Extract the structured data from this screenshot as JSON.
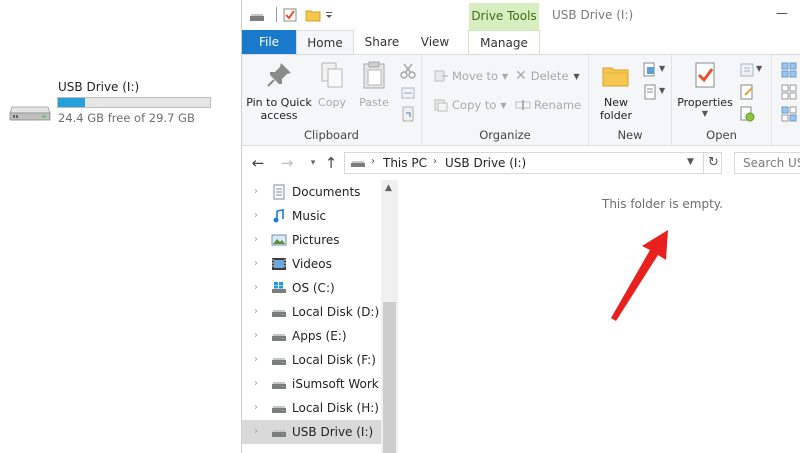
{
  "drive_tile": {
    "name": "USB Drive (I:)",
    "free_text": "24.4 GB free of 29.7 GB",
    "used_fraction": 0.18,
    "bar_color": "#26a0da"
  },
  "titlebar": {
    "contextual_tab": "Drive Tools",
    "window_title": "USB Drive (I:)",
    "minimize_glyph": "—"
  },
  "tabs": {
    "file": "File",
    "home": "Home",
    "share": "Share",
    "view": "View",
    "manage": "Manage"
  },
  "ribbon": {
    "clipboard": {
      "label": "Clipboard",
      "pin": "Pin to Quick access",
      "copy": "Copy",
      "paste": "Paste"
    },
    "organize": {
      "label": "Organize",
      "move_to": "Move to",
      "copy_to": "Copy to",
      "delete": "Delete",
      "rename": "Rename"
    },
    "new": {
      "label": "New",
      "new_folder": "New folder"
    },
    "open": {
      "label": "Open",
      "properties": "Properties"
    }
  },
  "address": {
    "crumbs": [
      "This PC",
      "USB Drive (I:)"
    ],
    "search_placeholder": "Search USB"
  },
  "nav_items": [
    {
      "label": "Documents",
      "icon": "documents-icon"
    },
    {
      "label": "Music",
      "icon": "music-icon"
    },
    {
      "label": "Pictures",
      "icon": "pictures-icon"
    },
    {
      "label": "Videos",
      "icon": "videos-icon"
    },
    {
      "label": "OS (C:)",
      "icon": "os-drive-icon"
    },
    {
      "label": "Local Disk (D:)",
      "icon": "drive-icon"
    },
    {
      "label": "Apps (E:)",
      "icon": "drive-icon"
    },
    {
      "label": "Local Disk (F:)",
      "icon": "drive-icon"
    },
    {
      "label": "iSumsoft Work (G:)",
      "icon": "drive-icon"
    },
    {
      "label": "Local Disk (H:)",
      "icon": "drive-icon"
    },
    {
      "label": "USB Drive (I:)",
      "icon": "usb-drive-icon",
      "selected": true
    }
  ],
  "content": {
    "empty_message": "This folder is empty.",
    "annotation_color": "#e8201e"
  }
}
